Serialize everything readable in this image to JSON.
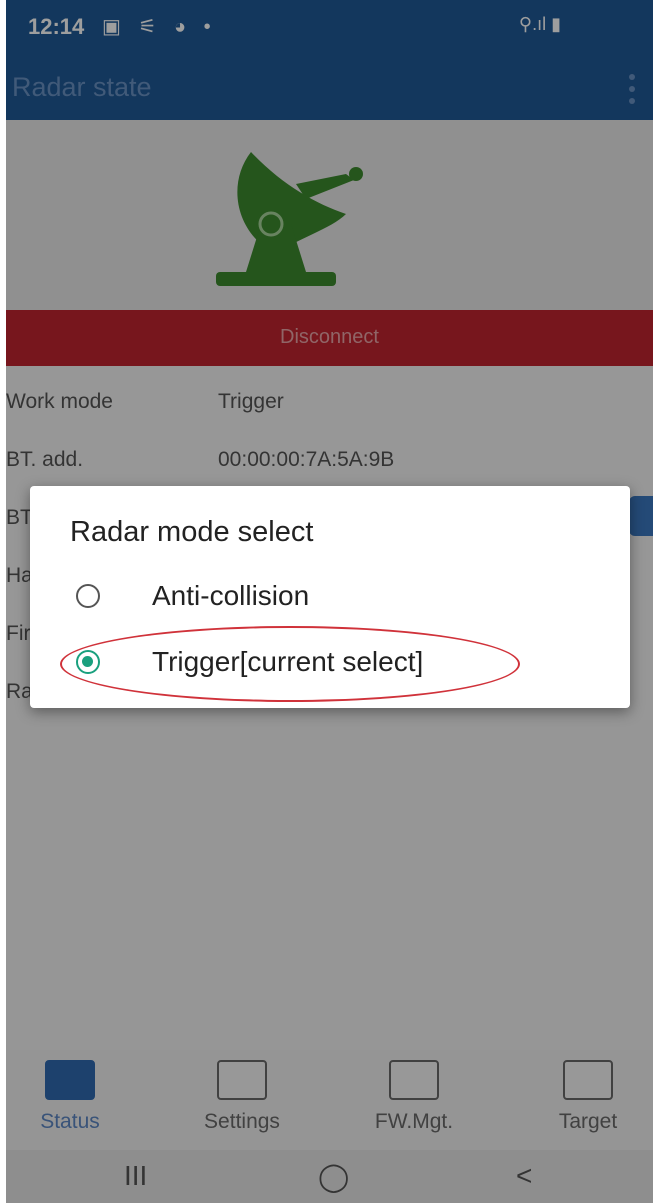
{
  "status_bar": {
    "time": "12:14",
    "left_icons": "▣ ⚟ ◕ •",
    "right_icons": "⚲.ıl ▮"
  },
  "app_bar": {
    "title": "Radar state"
  },
  "disconnect_label": "Disconnect",
  "info_rows": [
    {
      "key": "Work mode",
      "value": "Trigger"
    },
    {
      "key": "BT. add.",
      "value": "00:00:00:7A:5A:9B"
    },
    {
      "key": "BT",
      "value": ""
    },
    {
      "key": "Ha",
      "value": ""
    },
    {
      "key": "Fir",
      "value": ""
    },
    {
      "key": "Ra",
      "value": ""
    }
  ],
  "dialog": {
    "title": "Radar mode select",
    "options": [
      {
        "label": "Anti-collision",
        "checked": false
      },
      {
        "label": "Trigger[current select]",
        "checked": true
      }
    ]
  },
  "bottom_nav": [
    "Status",
    "Settings",
    "FW.Mgt.",
    "Target"
  ],
  "system_nav": {
    "recents": "III",
    "home": "◯",
    "back": "<"
  },
  "colors": {
    "app_bar": "#1f5a96",
    "disconnect": "#c0252f",
    "radio_checked": "#1aa07e",
    "highlight": "#d0323a",
    "radar_icon": "#3c8a2e"
  }
}
